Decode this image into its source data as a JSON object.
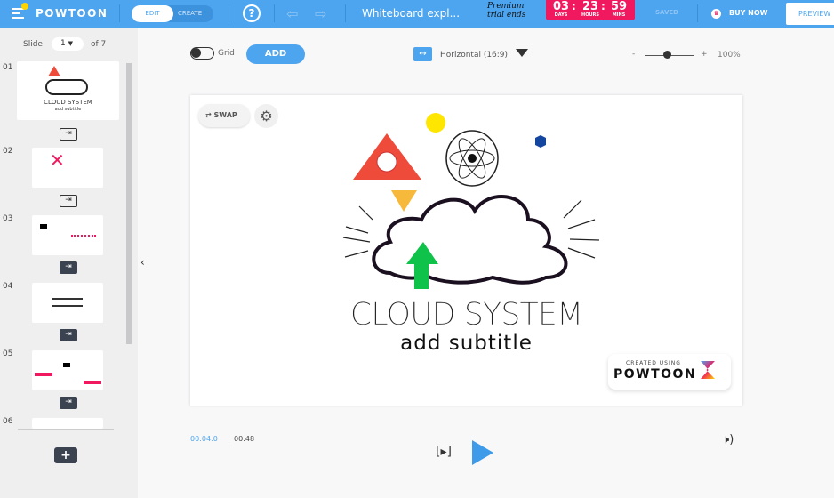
{
  "topbar": {
    "logo": "POWTOON",
    "edit": "EDIT",
    "create": "CREATE",
    "help": "?",
    "title": "Whiteboard expl...",
    "premium": "Premium trial ends",
    "timer": {
      "days": "03",
      "hours": "23",
      "mins": "59",
      "days_label": "DAYS",
      "hours_label": "HOURS",
      "mins_label": "MINS"
    },
    "saved": "SAVED",
    "buy_now": "BUY NOW",
    "preview": "PREVIEW"
  },
  "sidebar": {
    "slide_label": "Slide",
    "slide_value": "1",
    "of_label": "of 7",
    "slides": [
      {
        "num": "01"
      },
      {
        "num": "02"
      },
      {
        "num": "03"
      },
      {
        "num": "04"
      },
      {
        "num": "05"
      },
      {
        "num": "06"
      }
    ],
    "add": "+"
  },
  "toolbar": {
    "grid": "Grid",
    "add": "ADD",
    "orientation": "Horizontal (16:9)",
    "zoom_minus": "-",
    "zoom_plus": "+",
    "zoom": "100%",
    "zoom_level": 0.5
  },
  "canvas": {
    "swap": "SWAP",
    "title": "CLOUD SYSTEM",
    "subtitle": "add subtitle",
    "badge_small": "CREATED USING",
    "badge_brand": "POWTOON"
  },
  "player": {
    "current": "00:04:0",
    "total": "00:48"
  },
  "colors": {
    "accent": "#4ea5ef",
    "timer": "#f0185e"
  }
}
